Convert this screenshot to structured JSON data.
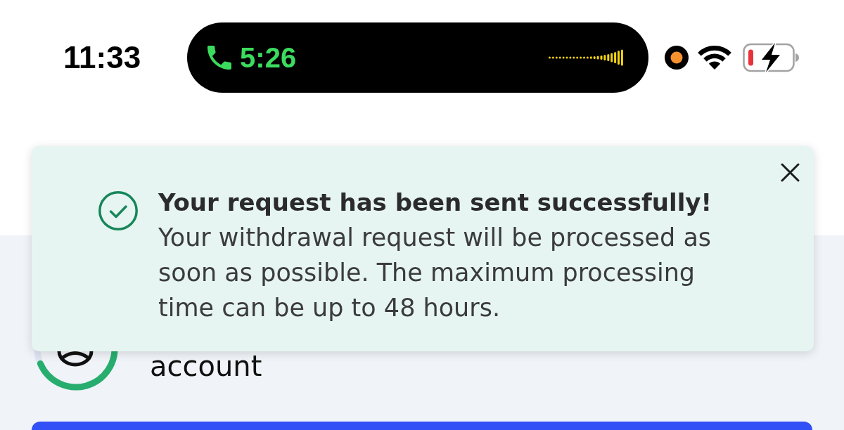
{
  "status_bar": {
    "time": "11:33",
    "call_timer": "5:26"
  },
  "toast": {
    "kind": "success",
    "title": "Your request has been sent successfully!",
    "message": "Your withdrawal request will be processed as soon as possible. The maximum processing time can be up to 48 hours."
  },
  "page": {
    "account_label": "account"
  }
}
